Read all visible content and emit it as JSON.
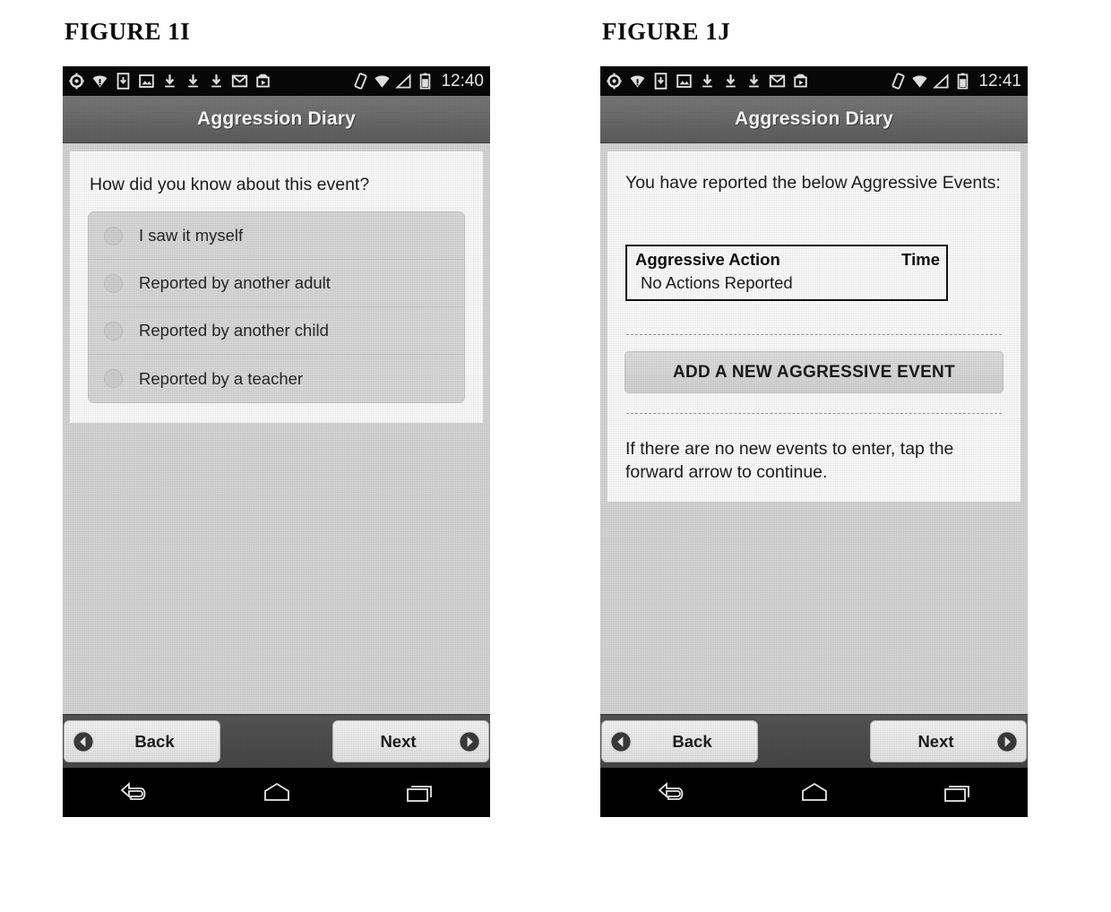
{
  "figures": [
    {
      "title": "FIGURE 1I",
      "statusbar": {
        "clock": "12:40",
        "left_icons": [
          "settings-icon",
          "wifi-alert-icon",
          "sim-card-icon",
          "screenshot-icon",
          "download-icon",
          "download-icon",
          "download-icon",
          "gmail-icon",
          "play-store-icon"
        ],
        "right_icons": [
          "rotate-lock-icon",
          "wifi-icon",
          "signal-icon",
          "battery-icon"
        ]
      },
      "app_title": "Aggression Diary",
      "screen": {
        "kind": "radio-question",
        "prompt": "How did you know about this event?",
        "options": [
          "I saw it myself",
          "Reported by another adult",
          "Reported by another child",
          "Reported by a teacher"
        ]
      },
      "wizard": {
        "back_label": "Back",
        "next_label": "Next"
      },
      "navbar": [
        "back-arrow-icon",
        "home-icon",
        "recents-icon"
      ]
    },
    {
      "title": "FIGURE 1J",
      "statusbar": {
        "clock": "12:41",
        "left_icons": [
          "settings-icon",
          "wifi-alert-icon",
          "sim-card-icon",
          "screenshot-icon",
          "download-icon",
          "download-icon",
          "download-icon",
          "gmail-icon",
          "play-store-icon"
        ],
        "right_icons": [
          "rotate-lock-icon",
          "wifi-icon",
          "signal-icon",
          "battery-icon"
        ]
      },
      "app_title": "Aggression Diary",
      "screen": {
        "kind": "event-summary",
        "prompt": "You have reported the below Aggressive Events:",
        "table": {
          "columns": [
            "Aggressive Action",
            "Time"
          ],
          "rows": [
            [
              "No Actions Reported",
              ""
            ]
          ]
        },
        "add_button": "ADD A NEW AGGRESSIVE EVENT",
        "hint": "If there are no new events to enter, tap the forward arrow to continue."
      },
      "wizard": {
        "back_label": "Back",
        "next_label": "Next"
      },
      "navbar": [
        "back-arrow-icon",
        "home-icon",
        "recents-icon"
      ]
    }
  ],
  "colors": {
    "status_bar": "#080808",
    "title_bar": "#6e6e6e",
    "wizard_bar": "#4b4b4b",
    "nav_bar": "#000000",
    "screen_bg": "#d9d9d9",
    "card_bg": "#ffffff",
    "list_row": "#dcdcdc",
    "text": "#1d1d1d",
    "title_text": "#ffffff"
  }
}
